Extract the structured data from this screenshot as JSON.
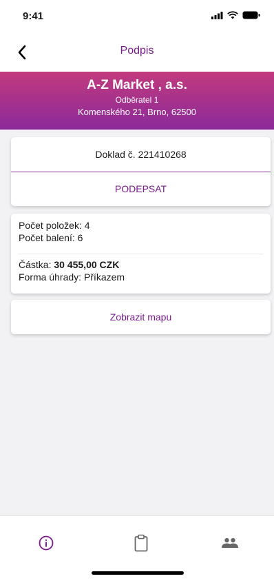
{
  "status": {
    "time": "9:41"
  },
  "nav": {
    "title": "Podpis"
  },
  "header": {
    "company": "A-Z Market , a.s.",
    "customer": "Odběratel 1",
    "address": "Komenského 21, Brno, 62500"
  },
  "document": {
    "number_label": "Doklad č. 221410268",
    "sign_label": "PODEPSAT"
  },
  "summary": {
    "items_label": "Počet položek:",
    "items_value": "4",
    "packages_label": "Počet balení:",
    "packages_value": "6",
    "amount_label": "Částka:",
    "amount_value": "30 455,00 CZK",
    "payment_label": "Forma úhrady:",
    "payment_value": "Příkazem"
  },
  "map": {
    "label": "Zobrazit mapu"
  },
  "tabs": [
    {
      "icon": "info-icon",
      "active": true
    },
    {
      "icon": "clipboard-icon",
      "active": false
    },
    {
      "icon": "people-icon",
      "active": false
    }
  ],
  "colors": {
    "accent": "#7a1a8e",
    "gradient_top": "#c23a7e",
    "gradient_bottom": "#8a2a9a",
    "inactive": "#777777"
  }
}
